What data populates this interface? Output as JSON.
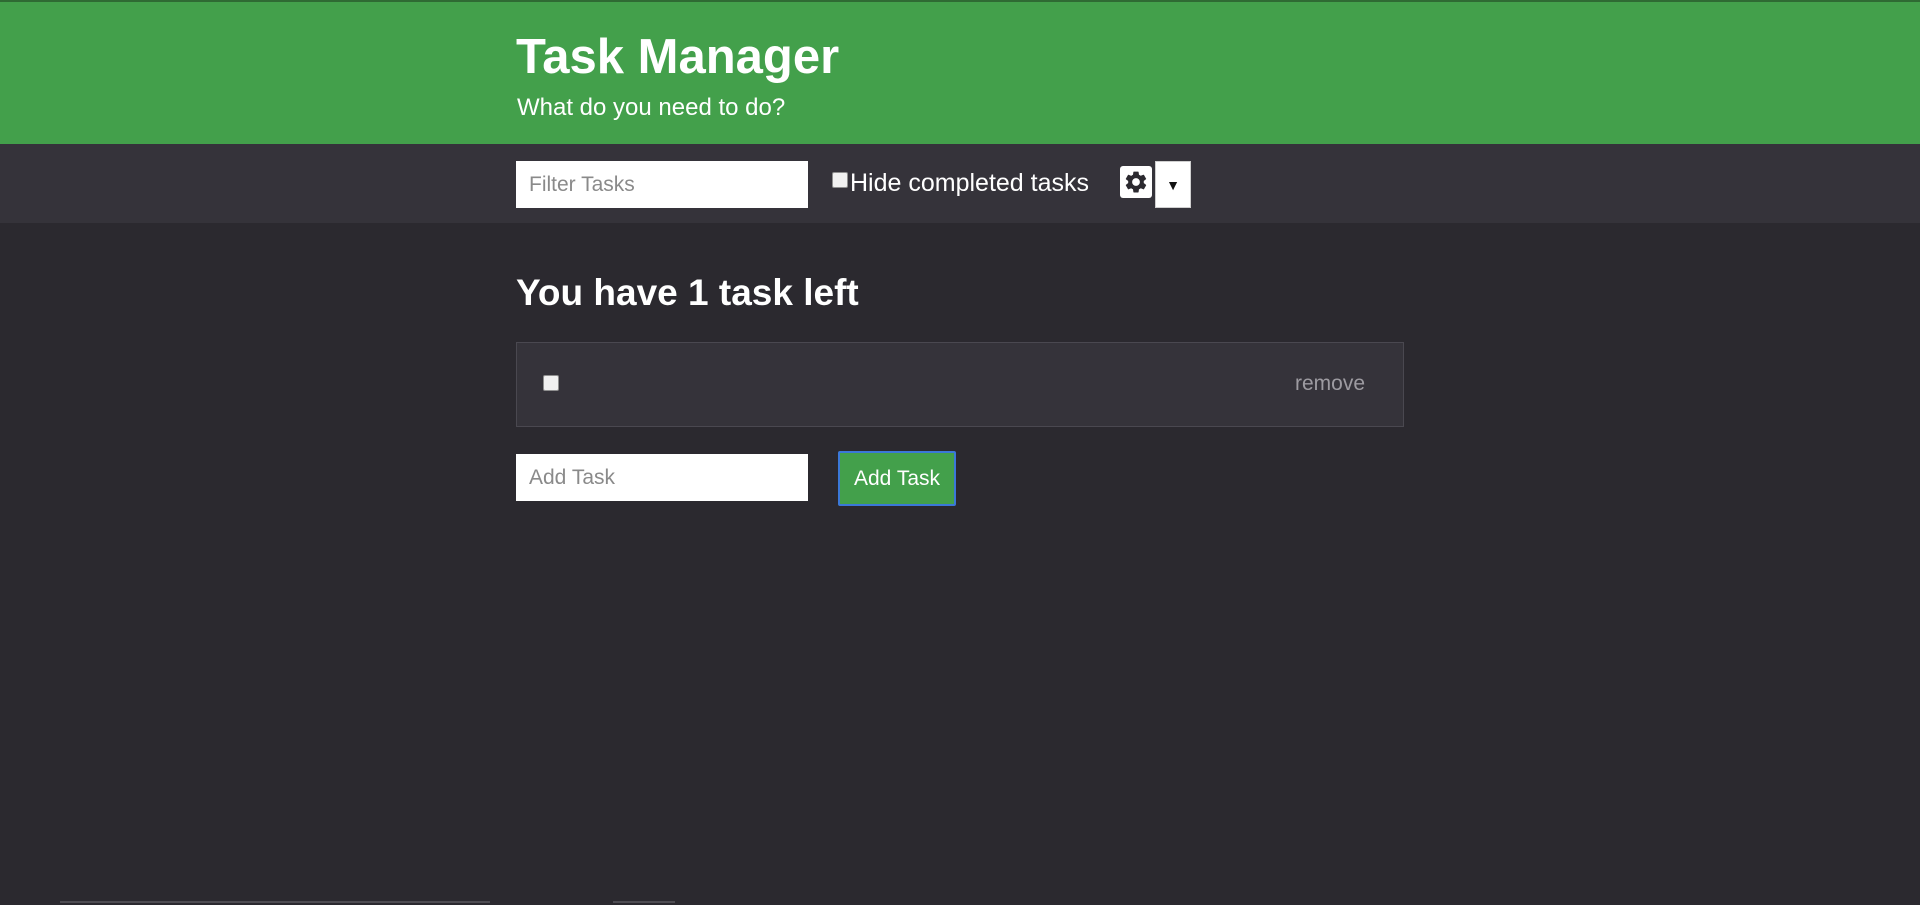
{
  "header": {
    "title": "Task Manager",
    "subtitle": "What do you need to do?"
  },
  "toolbar": {
    "filter_placeholder": "Filter Tasks",
    "hide_completed_label": "Hide completed tasks",
    "hide_completed_checked": false,
    "settings_icon": "gear-icon",
    "dropdown_glyph": "▼"
  },
  "main": {
    "heading": "You have 1 task left",
    "tasks": [
      {
        "text": "",
        "completed": false,
        "remove_label": "remove"
      }
    ],
    "add_task_placeholder": "Add Task",
    "add_task_button_label": "Add Task"
  },
  "colors": {
    "header_green": "#43a04b",
    "page_background": "#2b292f",
    "toolbar_background": "#35333a",
    "focus_ring": "#3b78d8"
  }
}
